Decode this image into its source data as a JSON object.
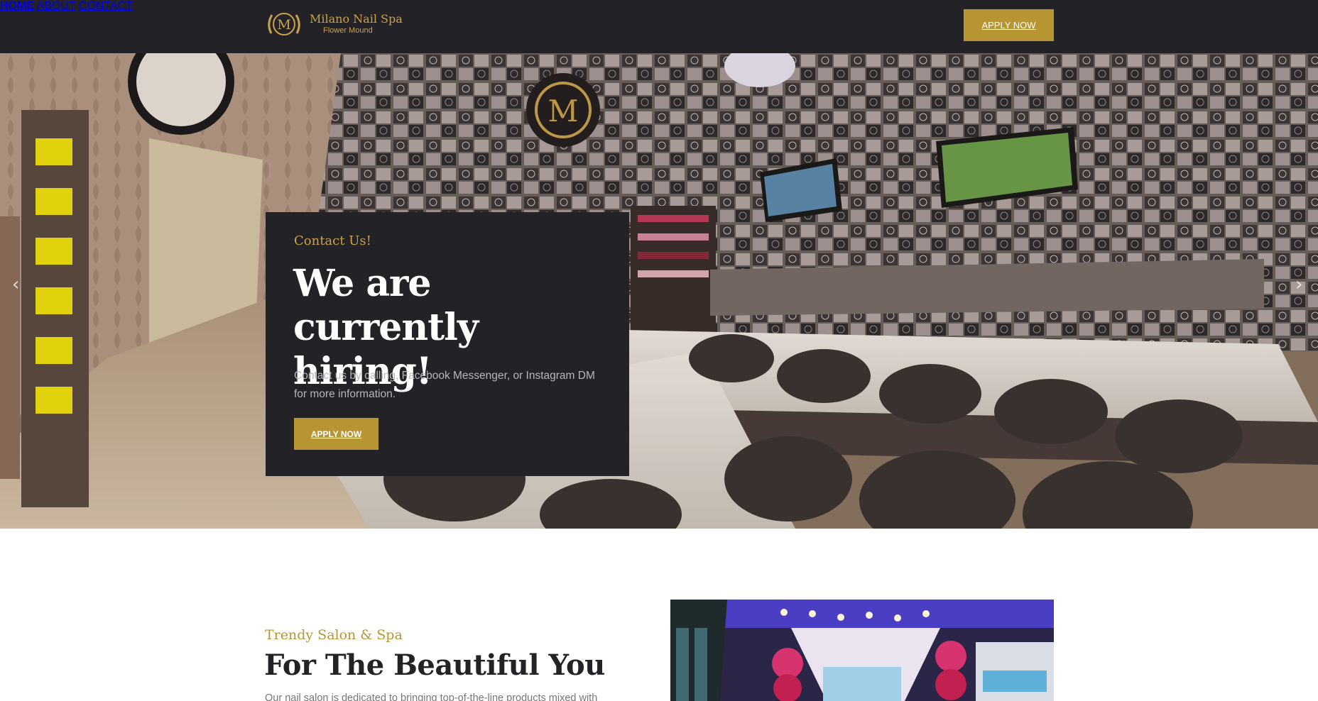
{
  "brand": {
    "name": "Milano Nail Spa",
    "location": "Flower Mound",
    "monogram": "M",
    "accent_color": "#b89533",
    "dark_color": "#232226"
  },
  "nav": {
    "items": [
      {
        "label": "HOME",
        "active": true
      },
      {
        "label": "ABOUT",
        "active": false
      },
      {
        "label": "CONTACT",
        "active": false
      }
    ],
    "apply_label": "APPLY NOW"
  },
  "hero": {
    "image": "salon-interior-photo",
    "prev_icon": "chevron-left-icon",
    "next_icon": "chevron-right-icon",
    "prev_glyph": "‹",
    "next_glyph": "›",
    "card": {
      "eyebrow": "Contact Us!",
      "title": "We are currently hiring!",
      "body": "Contact us by calling, Facebook Messenger, or Instagram DM for more information.",
      "apply_label": "APPLY NOW"
    }
  },
  "intro": {
    "eyebrow": "Trendy Salon & Spa",
    "title": "For The Beautiful You",
    "body": "Our nail salon is dedicated to bringing top-of-the-line products mixed with",
    "image": "salon-storefront-photo"
  }
}
